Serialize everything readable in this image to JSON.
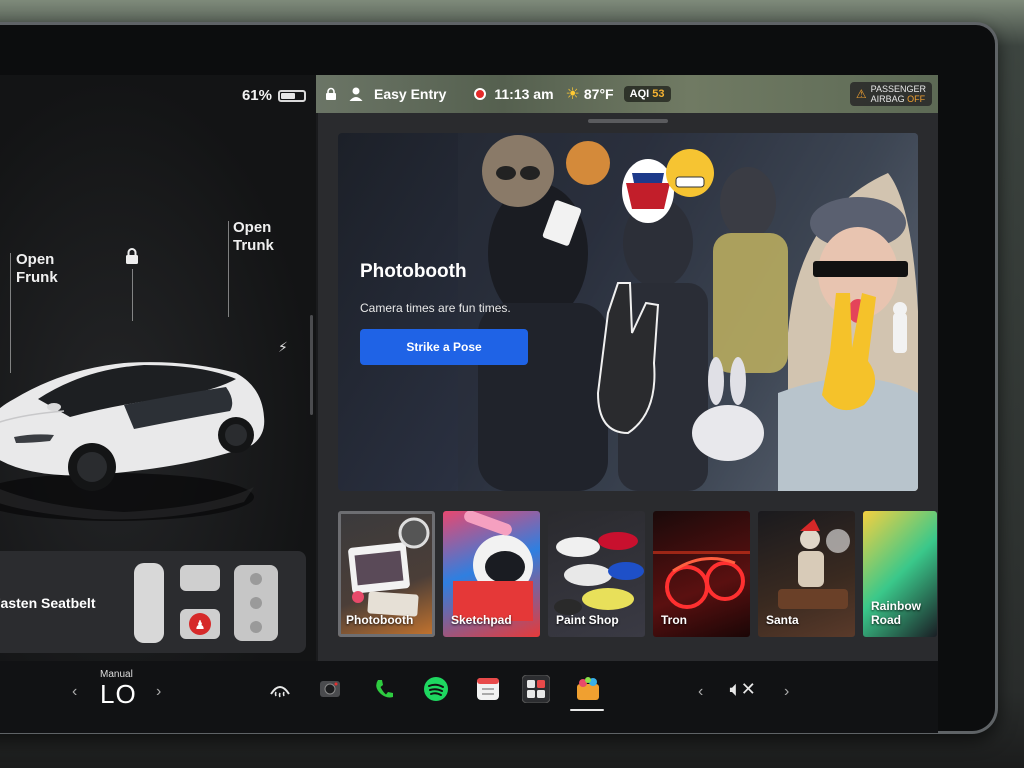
{
  "status": {
    "battery_percent": "61%",
    "battery_level": 0.61,
    "profile": "Easy Entry",
    "time": "11:13 am",
    "temperature": "87°F",
    "aqi_label": "AQI",
    "aqi_value": "53",
    "airbag_line1": "PASSENGER",
    "airbag_line2": "AIRBAG",
    "airbag_status": "OFF"
  },
  "car": {
    "frunk_line1": "Open",
    "frunk_line2": "Frunk",
    "trunk_line1": "Open",
    "trunk_line2": "Trunk"
  },
  "alert": {
    "seatbelt": "Fasten Seatbelt"
  },
  "hero": {
    "title": "Photobooth",
    "subtitle": "Camera times are fun times.",
    "cta": "Strike a Pose"
  },
  "tiles": [
    {
      "label": "Photobooth"
    },
    {
      "label": "Sketchpad"
    },
    {
      "label": "Paint Shop"
    },
    {
      "label": "Tron"
    },
    {
      "label": "Santa"
    },
    {
      "label_line1": "Rainbow",
      "label_line2": "Road"
    }
  ],
  "climate": {
    "mode": "Manual",
    "temp": "LO"
  },
  "colors": {
    "accent_blue": "#1f63e6",
    "record_red": "#e52a2a",
    "spotify_green": "#1ed760",
    "phone_green": "#2ecc40",
    "airbag_orange": "#f0a030"
  },
  "icons": [
    "lock-icon",
    "bolt-icon",
    "defrost-icon",
    "camera-icon",
    "phone-icon",
    "spotify-icon",
    "calendar-icon",
    "toybox-icon",
    "apps-icon",
    "volume-muted-icon"
  ]
}
